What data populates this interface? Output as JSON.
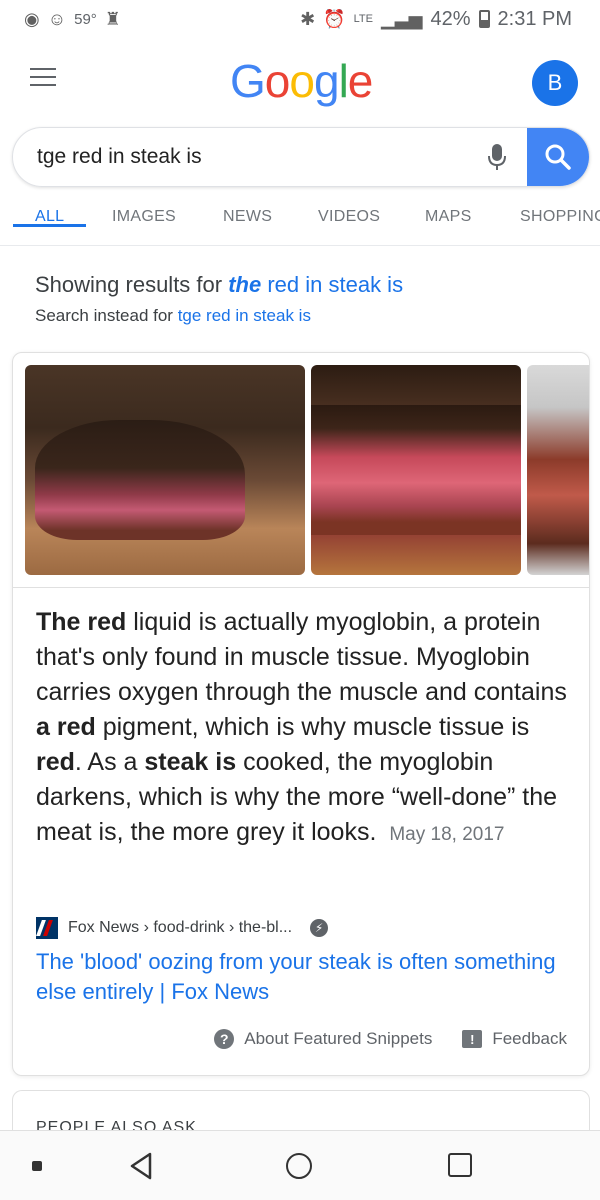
{
  "status_bar": {
    "temperature": "59°",
    "network_label": "LTE",
    "battery": "42%",
    "time": "2:31 PM"
  },
  "header": {
    "logo_text": "Google",
    "avatar_letter": "B"
  },
  "search": {
    "query": "tge red in steak is"
  },
  "tabs": [
    {
      "label": "ALL",
      "active": true
    },
    {
      "label": "IMAGES",
      "active": false
    },
    {
      "label": "NEWS",
      "active": false
    },
    {
      "label": "VIDEOS",
      "active": false
    },
    {
      "label": "MAPS",
      "active": false
    },
    {
      "label": "SHOPPING",
      "active": false
    }
  ],
  "spelling": {
    "showing_prefix": "Showing results for",
    "corrected_bold": "the",
    "corrected_rest": "red in steak is",
    "instead_prefix": "Search instead for",
    "original_query": "tge red in steak is"
  },
  "snippet": {
    "date": "May 18, 2017"
  },
  "source": {
    "breadcrumb": "Fox News › food-drink › the-bl...",
    "title": "The 'blood' oozing from your steak is often something else entirely | Fox News"
  },
  "card_footer": {
    "about_label": "About Featured Snippets",
    "feedback_label": "Feedback"
  },
  "paa": {
    "title": "PEOPLE ALSO ASK"
  },
  "colors": {
    "accent": "#1a73e8",
    "search_button": "#4285f4",
    "avatar": "#1a73e8"
  }
}
